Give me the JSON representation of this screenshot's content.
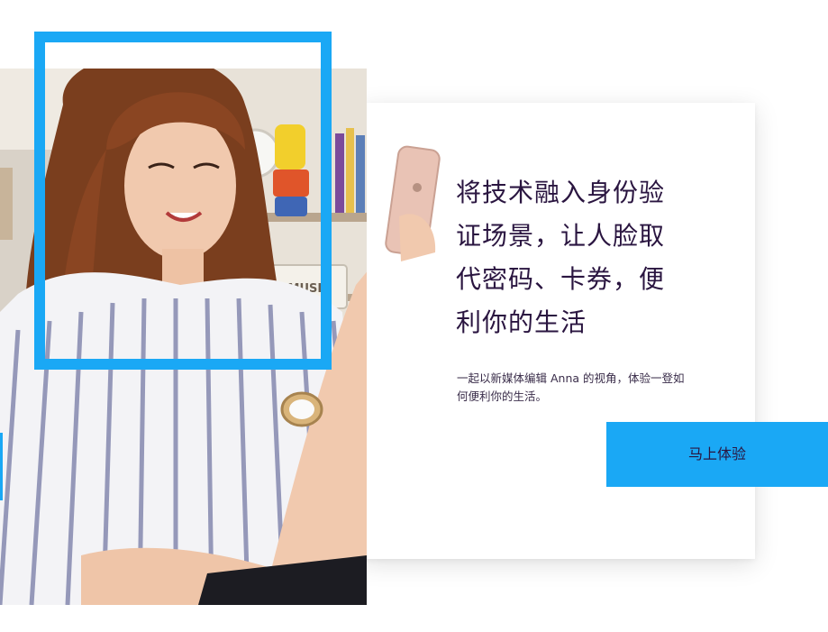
{
  "hero": {
    "headline": "将技术融入身份验证场景，让人脸取代密码、卡券，便利你的生活",
    "subtext": "一起以新媒体编辑 Anna 的视角，体验一登如何便利你的生活。",
    "cta_label": "马上体验"
  },
  "colors": {
    "accent": "#1aa8f5",
    "headline_text": "#2a1540",
    "card_background": "#ffffff"
  },
  "photo": {
    "description_icon": "person-photo",
    "shelf_sign": "AM MUSIC"
  }
}
